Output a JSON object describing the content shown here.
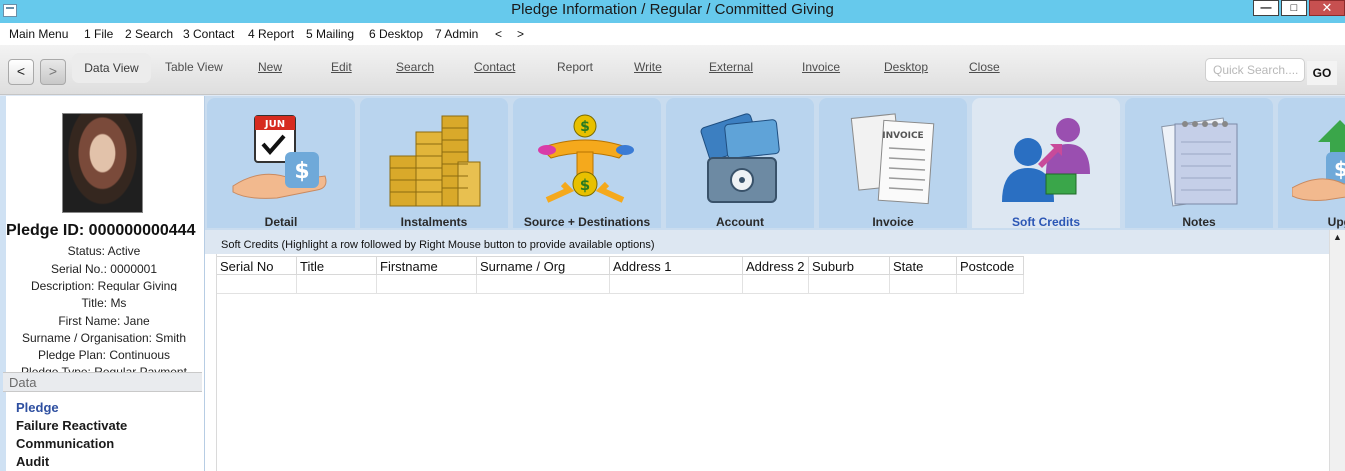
{
  "window": {
    "title": "Pledge Information / Regular / Committed Giving",
    "min_label": "—",
    "max_label": "□",
    "close_label": "✕"
  },
  "menu": [
    "Main Menu",
    "1 File",
    "2 Search",
    "3 Contact",
    "4 Report",
    "5 Mailing",
    "6 Desktop",
    "7 Admin",
    "<",
    ">"
  ],
  "toolbar": {
    "back_label": "<",
    "forward_label": ">",
    "data_view": "Data View",
    "table_view": "Table View",
    "new": "New",
    "edit": "Edit",
    "search": "Search",
    "contact": "Contact",
    "report": "Report",
    "write": "Write",
    "external": "External",
    "invoice": "Invoice",
    "desktop": "Desktop",
    "close": "Close",
    "quick_search_placeholder": "Quick Search....",
    "go": "GO"
  },
  "record": {
    "pledge_id": "Pledge ID: 000000000444",
    "status": "Status: Active",
    "serial": "Serial No.: 0000001",
    "description": "Description: Regular Giving",
    "title": "Title: Ms",
    "first_name": "First Name: Jane",
    "surname": "Surname / Organisation: Smith",
    "plan": "Pledge Plan: Continuous",
    "type": "Pledge Type: Regular Payment"
  },
  "data_section": {
    "header": "Data",
    "items": [
      "Pledge",
      "Failure Reactivate",
      "Communication",
      "Audit"
    ]
  },
  "tabs": [
    "Detail",
    "Instalments",
    "Source + Destinations",
    "Account",
    "Invoice",
    "Soft Credits",
    "Notes",
    "Upgrade"
  ],
  "active_tab": "Soft Credits",
  "soft_credits": {
    "heading": "Soft Credits  (Highlight a row followed by Right Mouse button to provide available options)",
    "columns": [
      "Serial No",
      "Title",
      "Firstname",
      "Surname / Org",
      "Address 1",
      "Address 2",
      "Suburb",
      "State",
      "Postcode"
    ]
  },
  "colors": {
    "titlebar": "#66c9ec",
    "tab_bg": "#b9d4ee",
    "active_tab_label": "#2b56b5",
    "active_data_link": "#2e4fa0"
  }
}
